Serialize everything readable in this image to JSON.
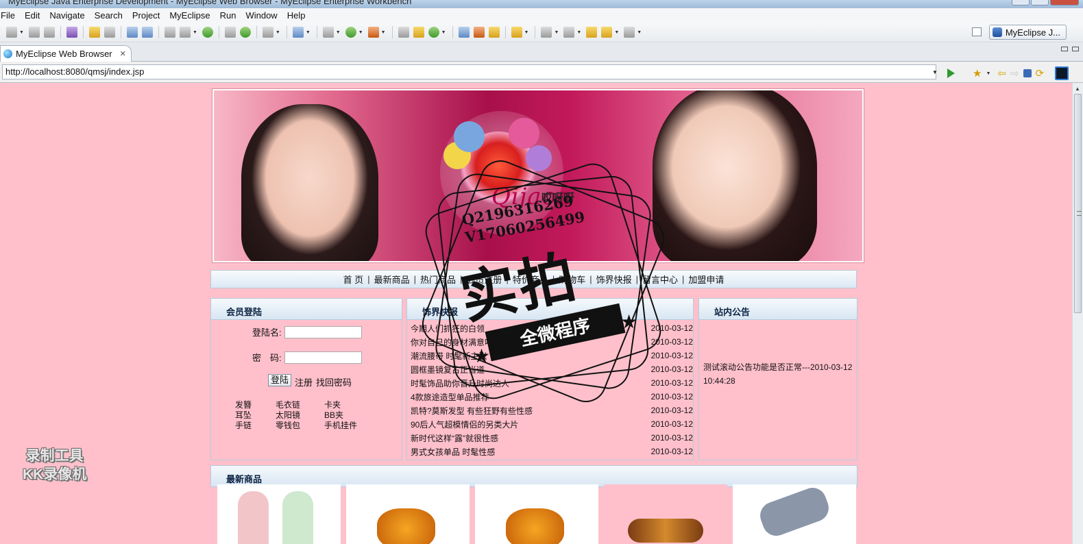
{
  "window": {
    "title": "MyEclipse Java Enterprise Development - MyEclipse Web Browser - MyEclipse Enterprise Workbench"
  },
  "menu": [
    "File",
    "Edit",
    "Navigate",
    "Search",
    "Project",
    "MyEclipse",
    "Run",
    "Window",
    "Help"
  ],
  "perspective": {
    "label": "MyEclipse J..."
  },
  "editor_tab": {
    "label": "MyEclipse Web Browser",
    "close": "✕"
  },
  "url": {
    "value": "http://localhost:8080/qmsj/index.jsp"
  },
  "site": {
    "banner": {
      "logo_text": "Qijaoa",
      "logo_cn": "哎呀呀"
    },
    "nav": [
      "首 页",
      "最新商品",
      "热门商品",
      "会员注册",
      "特价商品",
      "购物车",
      "饰界快报",
      "留言中心",
      "加盟申请"
    ],
    "login": {
      "title": "会员登陆",
      "username_label": "登陆名:",
      "password_label": "密　码:",
      "login_button": "登陆",
      "register_link": "注册",
      "recover_link": "找回密码",
      "categories": [
        "发簪",
        "毛衣链",
        "卡夹",
        "耳坠",
        "太阳镜",
        "BB夹",
        "手链",
        "零钱包",
        "手机挂件"
      ]
    },
    "news": {
      "title": "饰界快报",
      "items": [
        {
          "title": "今期人们抓狂的白领",
          "date": "2010-03-12"
        },
        {
          "title": "你对自己的身材满意吗?",
          "date": "2010-03-12"
        },
        {
          "title": "潮流腰带 时髦新主张",
          "date": "2010-03-12"
        },
        {
          "title": "圆框墨镜复古正当道",
          "date": "2010-03-12"
        },
        {
          "title": "时髦饰品助你晋升时尚达人",
          "date": "2010-03-12"
        },
        {
          "title": "4款旅途造型单品推荐",
          "date": "2010-03-12"
        },
        {
          "title": "凯特?莫斯发型 有些狂野有些性感",
          "date": "2010-03-12"
        },
        {
          "title": "90后人气超模情侣的另类大片",
          "date": "2010-03-12"
        },
        {
          "title": "新时代这样“露”就很性感",
          "date": "2010-03-12"
        },
        {
          "title": "男式女孩单品 时髦性感",
          "date": "2010-03-12"
        }
      ]
    },
    "notice": {
      "title": "站内公告",
      "text": "测试滚动公告功能是否正常---2010-03-12 10:44:28"
    },
    "latest": {
      "title": "最新商品"
    }
  },
  "watermark": {
    "qq": "Q2196316269",
    "wx": "V17060256499",
    "big": "实拍",
    "ribbon": "全微程序"
  },
  "recorder": {
    "line1": "录制工具",
    "line2": "KK录像机"
  },
  "colors": {
    "page_bg": "#ffc0cb",
    "panel_head": "#d8e6f2",
    "title_text": "#0b2242"
  }
}
